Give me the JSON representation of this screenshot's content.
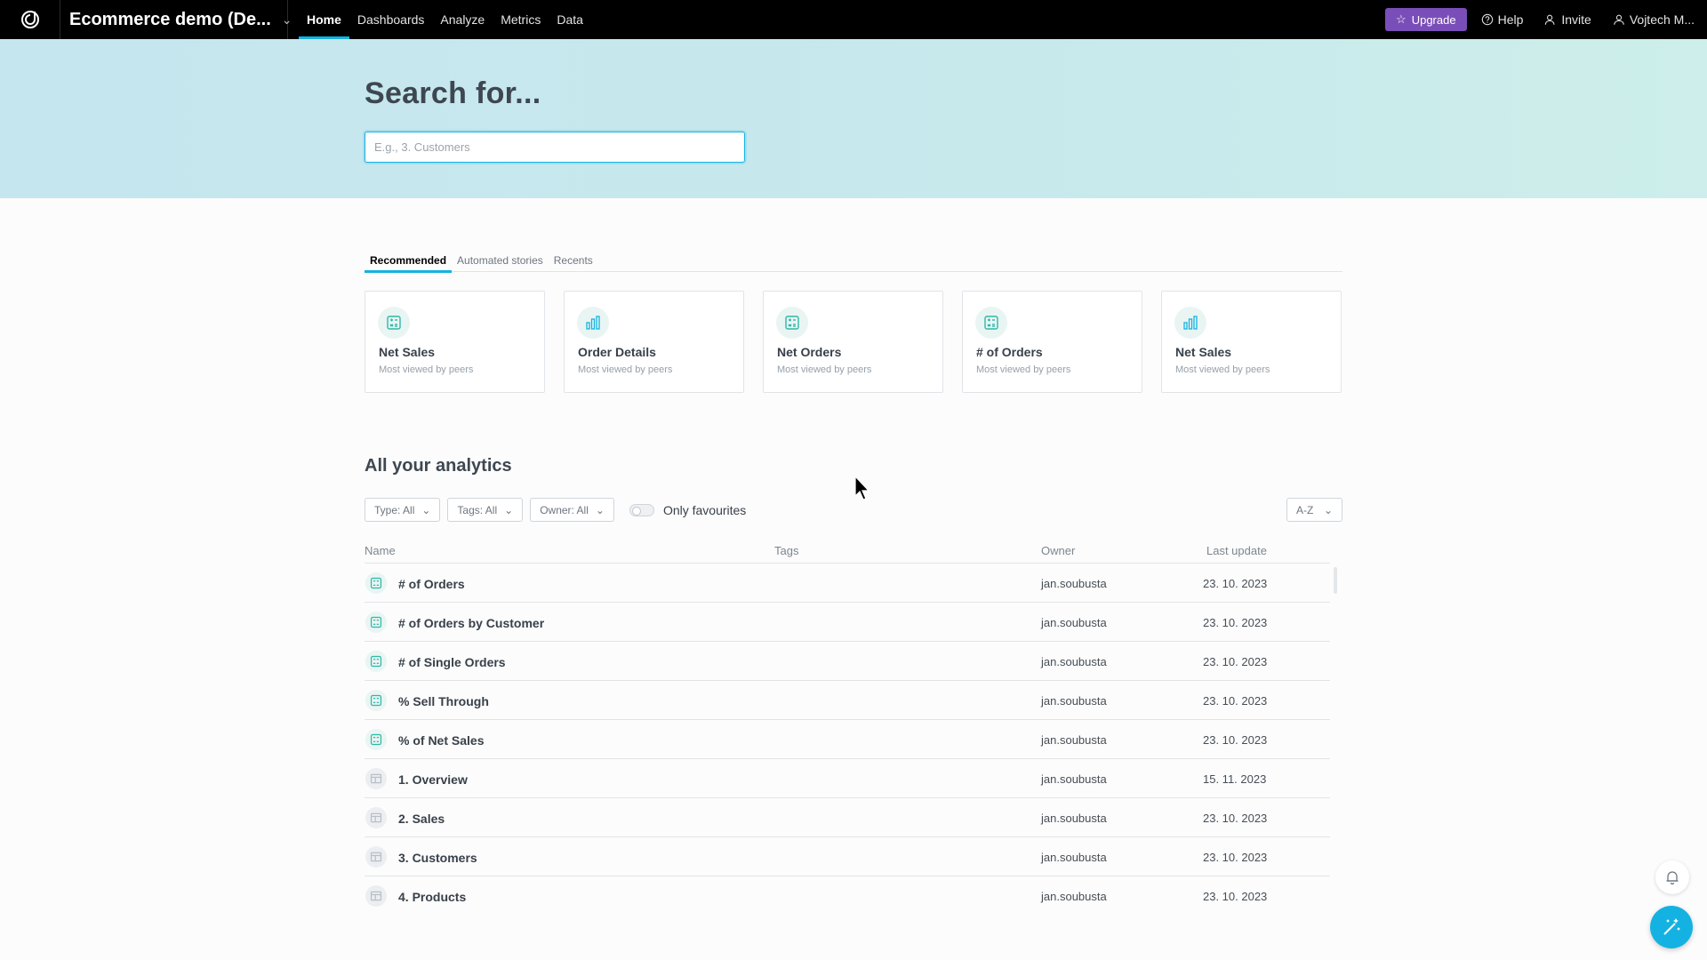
{
  "topbar": {
    "workspace_name": "Ecommerce demo (De...",
    "nav": [
      {
        "label": "Home",
        "active": true
      },
      {
        "label": "Dashboards"
      },
      {
        "label": "Analyze"
      },
      {
        "label": "Metrics"
      },
      {
        "label": "Data"
      }
    ],
    "upgrade_label": "Upgrade",
    "help_label": "Help",
    "invite_label": "Invite",
    "user_label": "Vojtech M...",
    "upgrade_color": "#7a4eb8"
  },
  "hero": {
    "title": "Search for...",
    "search_placeholder": "E.g., 3. Customers"
  },
  "tabs": [
    "Recommended",
    "Automated stories",
    "Recents"
  ],
  "recommended": [
    {
      "title": "Net Sales",
      "subtitle": "Most viewed by peers",
      "icon": "metric-icon"
    },
    {
      "title": "Order Details",
      "subtitle": "Most viewed by peers",
      "icon": "bar-chart-icon"
    },
    {
      "title": "Net Orders",
      "subtitle": "Most viewed by peers",
      "icon": "metric-icon"
    },
    {
      "title": "# of Orders",
      "subtitle": "Most viewed by peers",
      "icon": "metric-icon"
    },
    {
      "title": "Net Sales",
      "subtitle": "Most viewed by peers",
      "icon": "bar-chart-icon"
    }
  ],
  "analytics": {
    "title": "All your analytics",
    "filters": {
      "type": "Type: All",
      "tags": "Tags: All",
      "owner": "Owner: All",
      "only_favourites": "Only favourites",
      "sort": "A-Z"
    },
    "columns": {
      "name": "Name",
      "tags": "Tags",
      "owner": "Owner",
      "last_update": "Last update"
    },
    "rows": [
      {
        "name": "# of Orders",
        "owner": "jan.soubusta",
        "date": "23. 10. 2023",
        "kind": "metric"
      },
      {
        "name": "# of Orders by Customer",
        "owner": "jan.soubusta",
        "date": "23. 10. 2023",
        "kind": "metric"
      },
      {
        "name": "# of Single Orders",
        "owner": "jan.soubusta",
        "date": "23. 10. 2023",
        "kind": "metric"
      },
      {
        "name": "% Sell Through",
        "owner": "jan.soubusta",
        "date": "23. 10. 2023",
        "kind": "metric"
      },
      {
        "name": "% of Net Sales",
        "owner": "jan.soubusta",
        "date": "23. 10. 2023",
        "kind": "metric"
      },
      {
        "name": "1. Overview",
        "owner": "jan.soubusta",
        "date": "15. 11. 2023",
        "kind": "dashboard"
      },
      {
        "name": "2. Sales",
        "owner": "jan.soubusta",
        "date": "23. 10. 2023",
        "kind": "dashboard"
      },
      {
        "name": "3. Customers",
        "owner": "jan.soubusta",
        "date": "23. 10. 2023",
        "kind": "dashboard"
      },
      {
        "name": "4. Products",
        "owner": "jan.soubusta",
        "date": "23. 10. 2023",
        "kind": "dashboard"
      }
    ]
  },
  "colors": {
    "accent": "#14b2e2",
    "metric_icon": "#2fb8a6",
    "topbar": "#000000"
  }
}
